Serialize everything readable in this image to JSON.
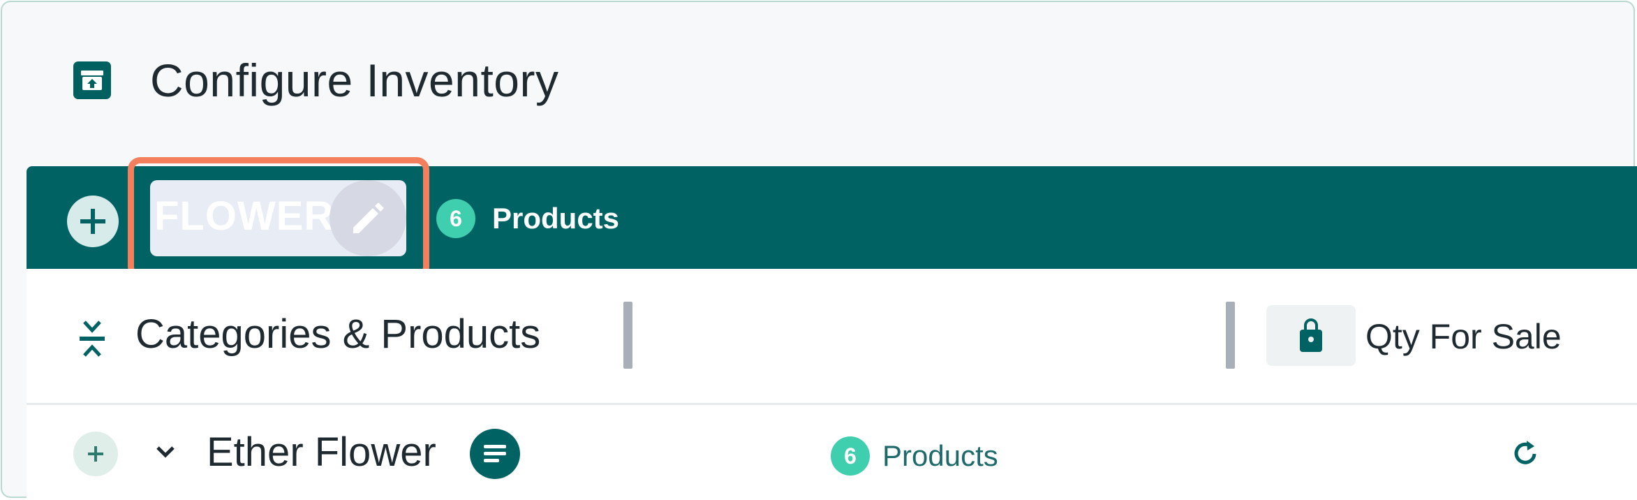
{
  "page": {
    "title": "Configure Inventory",
    "title_icon": "inventory-box-icon"
  },
  "category_bar": {
    "add_icon": "plus-circle-icon",
    "category_name": "FLOWER",
    "edit_icon": "pencil-icon",
    "product_count": "6",
    "products_label": "Products"
  },
  "columns": {
    "collapse_icon": "collapse-vertical-icon",
    "categories_label": "Categories & Products",
    "qty_icon": "shopping-bag-icon",
    "qty_label": "Qty For Sale"
  },
  "rows": [
    {
      "name": "Ether Flower",
      "product_count": "6",
      "products_label": "Products",
      "icons": [
        "plus-icon",
        "chevron-down-icon",
        "menu-lines-icon",
        "refresh-icon"
      ]
    }
  ],
  "colors": {
    "brand_teal": "#006262",
    "accent_green": "#3fcfae",
    "highlight": "#f47f5c"
  }
}
